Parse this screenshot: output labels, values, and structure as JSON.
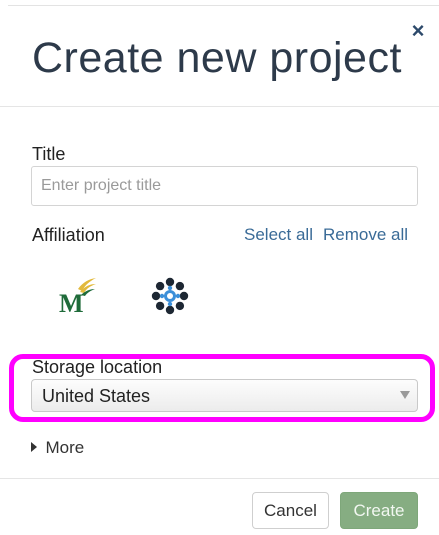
{
  "modal": {
    "title": "Create new project",
    "close_glyph": "×"
  },
  "form": {
    "title_label": "Title",
    "title_placeholder": "Enter project title",
    "title_value": "",
    "affiliation_label": "Affiliation",
    "select_all_label": "Select all",
    "remove_all_label": "Remove all",
    "affiliations": [
      {
        "icon": "gmu-m-logo-icon",
        "selected": false
      },
      {
        "icon": "flower-ring-logo-icon",
        "selected": false
      }
    ],
    "storage_label": "Storage location",
    "storage_value": "United States",
    "more_label": "More"
  },
  "footer": {
    "cancel_label": "Cancel",
    "create_label": "Create"
  },
  "colors": {
    "title_text": "#2d3a4a",
    "link": "#3a6b97",
    "create_button": "#86ad82",
    "highlight": "#ff00ff",
    "gmu_green": "#1f6b3a",
    "gmu_gold": "#e2b93b",
    "flower_dark": "#1d2733",
    "flower_blue": "#3b8fd9"
  }
}
